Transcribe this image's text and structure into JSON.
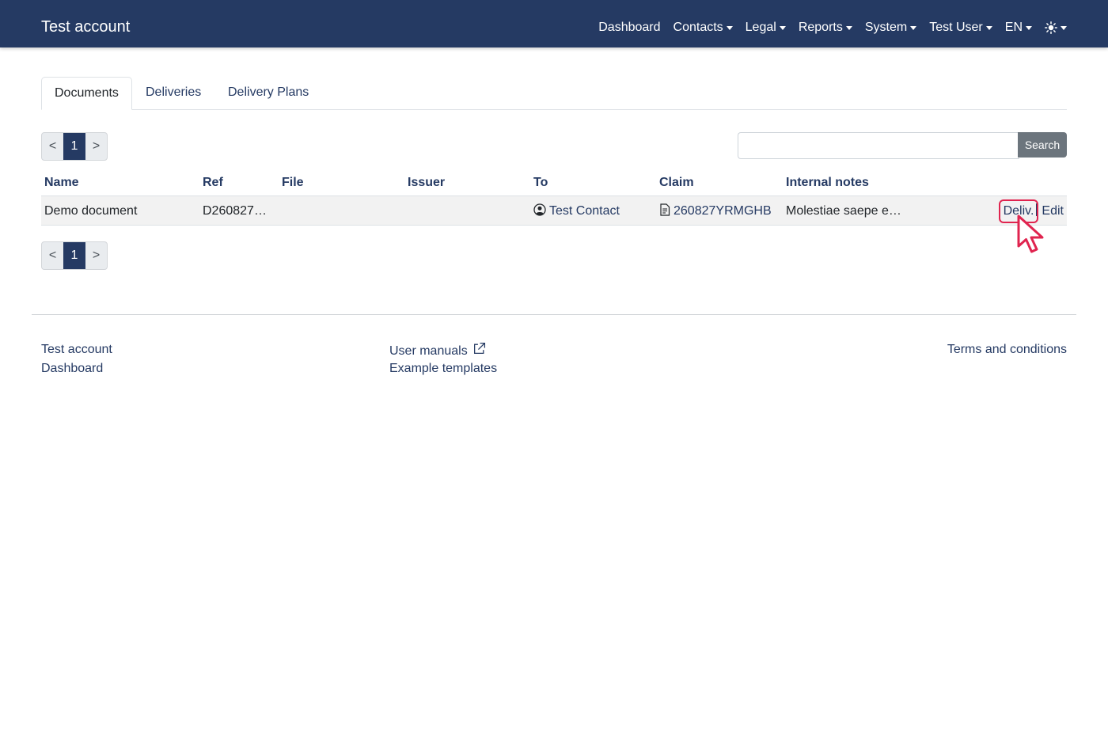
{
  "navbar": {
    "brand": "Test account",
    "items": [
      {
        "label": "Dashboard",
        "dropdown": false
      },
      {
        "label": "Contacts",
        "dropdown": true
      },
      {
        "label": "Legal",
        "dropdown": true
      },
      {
        "label": "Reports",
        "dropdown": true
      },
      {
        "label": "System",
        "dropdown": true
      },
      {
        "label": "Test User",
        "dropdown": true
      },
      {
        "label": "EN",
        "dropdown": true
      }
    ],
    "theme_icon": "sun-icon"
  },
  "tabs": [
    {
      "label": "Documents",
      "active": true
    },
    {
      "label": "Deliveries",
      "active": false
    },
    {
      "label": "Delivery Plans",
      "active": false
    }
  ],
  "pagination": {
    "prev": "<",
    "current": "1",
    "next": ">"
  },
  "search": {
    "value": "",
    "placeholder": "",
    "button": "Search"
  },
  "table": {
    "headers": {
      "name": "Name",
      "ref": "Ref",
      "file": "File",
      "issuer": "Issuer",
      "to": "To",
      "claim": "Claim",
      "notes": "Internal notes"
    },
    "rows": [
      {
        "name": "Demo document",
        "ref": "D260827…",
        "file": "",
        "issuer": "",
        "to": "Test Contact",
        "claim": "260827YRMGHB",
        "notes": "Molestiae saepe e…",
        "action_deliv": "Deliv.",
        "action_edit": "Edit"
      }
    ]
  },
  "footer": {
    "col1": [
      "Test account",
      "Dashboard"
    ],
    "col2": [
      "User manuals",
      "Example templates"
    ],
    "col3": [
      "Terms and conditions"
    ]
  },
  "colors": {
    "navbar": "#253a63",
    "link": "#253a63",
    "highlight": "#e0244f",
    "search_button": "#6c757d"
  }
}
